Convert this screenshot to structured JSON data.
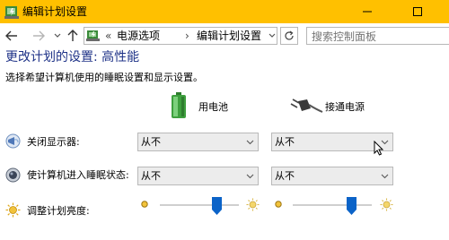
{
  "window": {
    "title": "编辑计划设置"
  },
  "address": {
    "separator": "«",
    "crumbs": [
      "电源选项",
      "编辑计划设置"
    ],
    "crumb_separator": "›"
  },
  "search": {
    "placeholder": "搜索控制面板"
  },
  "main": {
    "title": "更改计划的设置: 高性能",
    "subtitle": "选择希望计算机使用的睡眠设置和显示设置。",
    "columns": {
      "battery": "用电池",
      "plugged_in": "接通电源"
    },
    "rows": {
      "display_off": {
        "label": "关闭显示器:",
        "battery_value": "从不",
        "plugged_value": "从不"
      },
      "sleep": {
        "label": "使计算机进入睡眠状态:",
        "battery_value": "从不",
        "plugged_value": "从不"
      },
      "brightness": {
        "label": "调整计划亮度:",
        "battery_level": 0.72,
        "plugged_level": 0.74
      }
    }
  },
  "colors": {
    "titlebar": "#ffc000",
    "title_text": "#1e3287",
    "slider_thumb": "#0b63c8"
  }
}
